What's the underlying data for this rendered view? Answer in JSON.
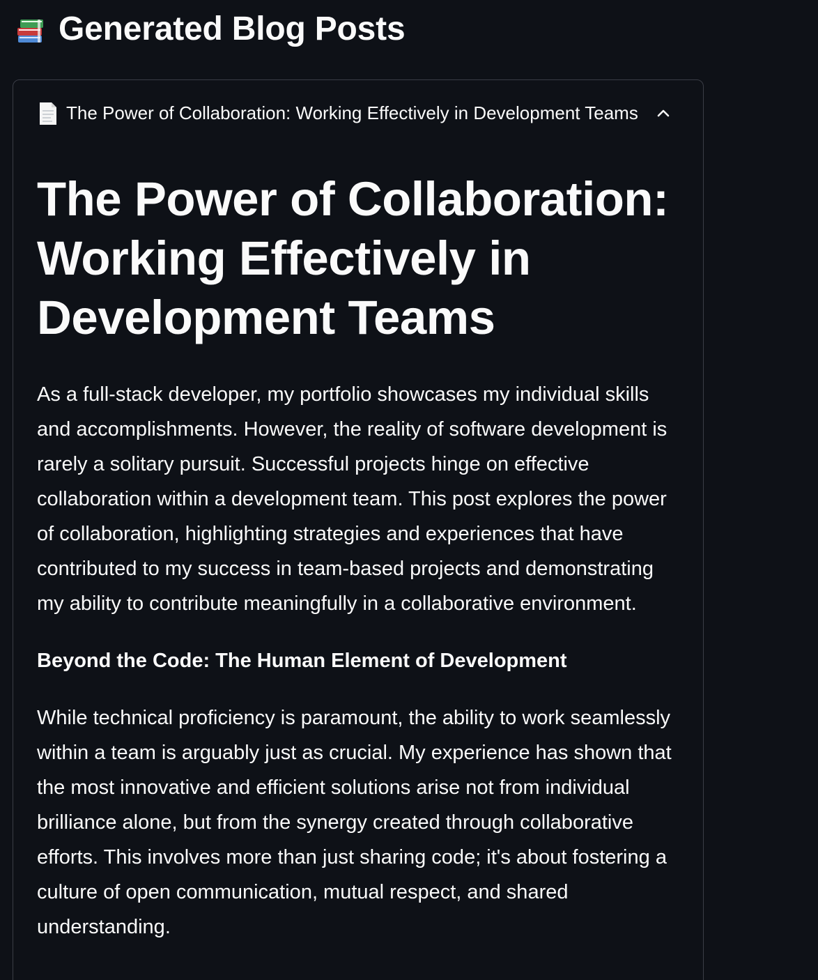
{
  "page": {
    "title": "Generated Blog Posts",
    "title_icon": "books-icon"
  },
  "expander": {
    "icon": "page-facing-up-icon",
    "label": "The Power of Collaboration: Working Effectively in Development Teams",
    "state_icon": "chevron-up-icon",
    "expanded": true
  },
  "post": {
    "heading": "The Power of Collaboration: Working Effectively in Development Teams",
    "intro": "As a full-stack developer, my portfolio showcases my individual skills and accomplishments. However, the reality of software development is rarely a solitary pursuit. Successful projects hinge on effective collaboration within a development team. This post explores the power of collaboration, highlighting strategies and experiences that have contributed to my success in team-based projects and demonstrating my ability to contribute meaningfully in a collaborative environment.",
    "section_title": "Beyond the Code: The Human Element of Development",
    "section_paragraph": "While technical proficiency is paramount, the ability to work seamlessly within a team is arguably just as crucial. My experience has shown that the most innovative and efficient solutions arise not from individual brilliance alone, but from the synergy created through collaborative efforts. This involves more than just sharing code; it's about fostering a culture of open communication, mutual respect, and shared understanding."
  },
  "colors": {
    "background": "#0e1117",
    "text": "#fafafa",
    "border": "#3a3d46"
  }
}
